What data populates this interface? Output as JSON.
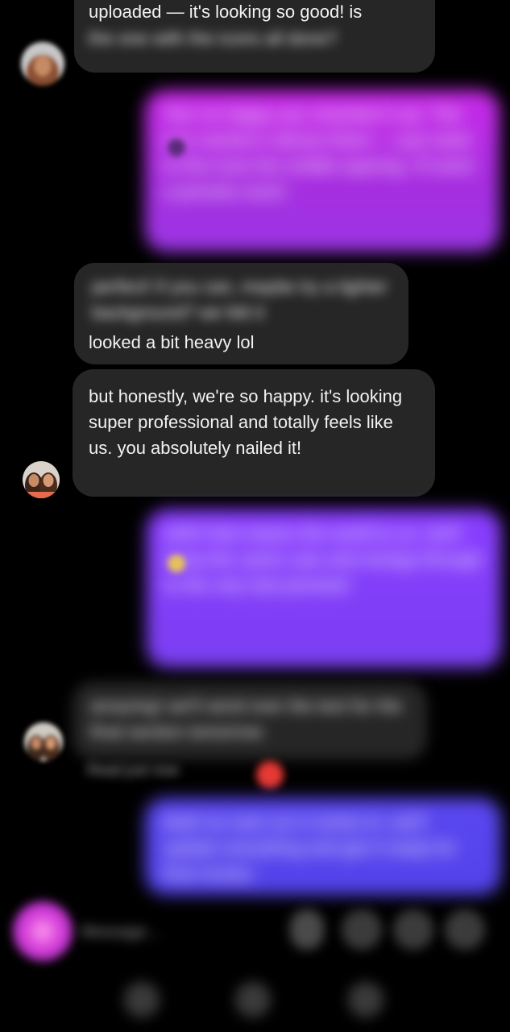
{
  "messages": {
    "top": {
      "visible_text": "uploaded — it's looking so good! is",
      "blurred_text": "the one with the icons all done?"
    },
    "out_1": {
      "text": "Yes! so happy you checked it out. The icon section's almost there — just need to fine tune the mobile spacing. I'll send a preview soon!"
    },
    "in_2": {
      "blurred_text": "perfect! if you can, maybe try a lighter background? we felt it",
      "visible_tail": "looked a bit heavy lol"
    },
    "in_3": {
      "text": "but honestly, we're so happy. it's looking super professional and totally feels like us. you absolutely nailed it!"
    },
    "out_4": {
      "text": "ahhh that means the world to us. we'll keep this same care and energy through to the very last preview!"
    },
    "in_5": {
      "text": "amazing! we'll send over the text for the final section tomorrow",
      "meta": "Read just now"
    },
    "out_6": {
      "text": "deal! as soon as it comes in, we'll update everything and get it ready for final review."
    }
  },
  "composer": {
    "placeholder": "Message..."
  },
  "colors": {
    "background": "#000000",
    "incoming_bubble": "#262626",
    "outgoing_magenta": "#b52fe4",
    "outgoing_violet": "#803ef8",
    "outgoing_blue": "#5745ee"
  },
  "icons": {
    "camera": "camera-icon",
    "mic": "mic-icon",
    "image": "image-icon",
    "sticker": "sticker-icon",
    "plus": "plus-icon",
    "nav_back": "nav-back-icon",
    "nav_home": "nav-home-icon",
    "nav_recents": "nav-recents-icon"
  }
}
